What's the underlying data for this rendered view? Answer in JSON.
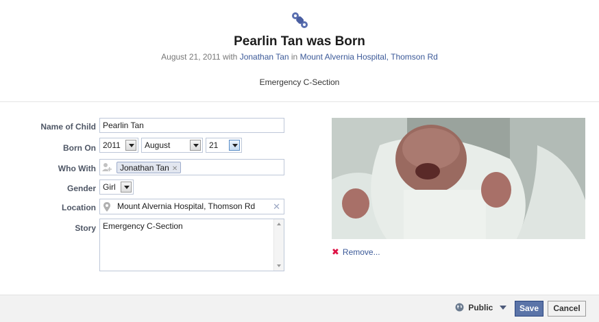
{
  "header": {
    "icon": "pacifier-icon",
    "title": "Pearlin Tan was Born",
    "date": "August 21, 2011",
    "with_word": "with",
    "with_person": "Jonathan Tan",
    "in_word": "in",
    "place": "Mount Alvernia Hospital",
    "place_sep": ",",
    "city": "Thomson Rd",
    "story": "Emergency C-Section"
  },
  "form": {
    "name_label": "Name of Child",
    "name_value": "Pearlin Tan",
    "born_label": "Born On",
    "born_year": "2011",
    "born_month": "August",
    "born_day": "21",
    "with_label": "Who With",
    "with_token": "Jonathan Tan",
    "gender_label": "Gender",
    "gender_value": "Girl",
    "location_label": "Location",
    "location_value": "Mount Alvernia Hospital, Thomson Rd",
    "story_label": "Story",
    "story_value": "Emergency C-Section"
  },
  "photo": {
    "remove_label": "Remove..."
  },
  "footer": {
    "privacy_label": "Public",
    "save_label": "Save",
    "cancel_label": "Cancel"
  },
  "colors": {
    "link": "#3b5998",
    "save_bg": "#5b74a8",
    "remove_x": "#dd3333"
  }
}
